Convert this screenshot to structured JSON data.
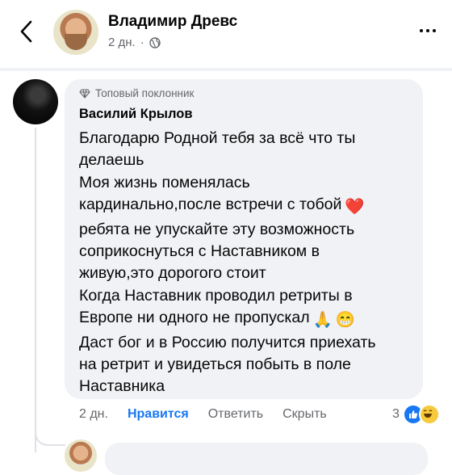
{
  "header": {
    "author_name": "Владимир Древс",
    "time": "2 дн.",
    "separator": "·",
    "icons": [
      "back-icon",
      "globe-icon",
      "more-icon"
    ]
  },
  "comment": {
    "badge": "Топовый поклонник",
    "name": "Василий Крылов",
    "lines": [
      "Благодарю Родной тебя за всё что ты",
      "делаешь",
      "Моя жизнь поменялась",
      "кардинально,после встречи с тобой",
      "ребята не упускайте эту возможность",
      "соприкоснуться с Наставником в",
      "живую,это дорогого стоит",
      "Когда Наставник проводил ретриты в",
      "Европе ни одного не пропускал",
      "Даст бог и в Россию получится приехать",
      "на ретрит и увидеться побыть в поле",
      "Наставника"
    ],
    "emoji": {
      "heart": "❤️",
      "pray": "🙏",
      "grin": "😁"
    }
  },
  "actions": {
    "time": "2 дн.",
    "like": "Нравится",
    "reply": "Ответить",
    "hide": "Скрыть",
    "reaction_count": "3"
  },
  "colors": {
    "accent": "#1877f2",
    "bubble": "#f0f2f5",
    "muted": "#65676b"
  }
}
